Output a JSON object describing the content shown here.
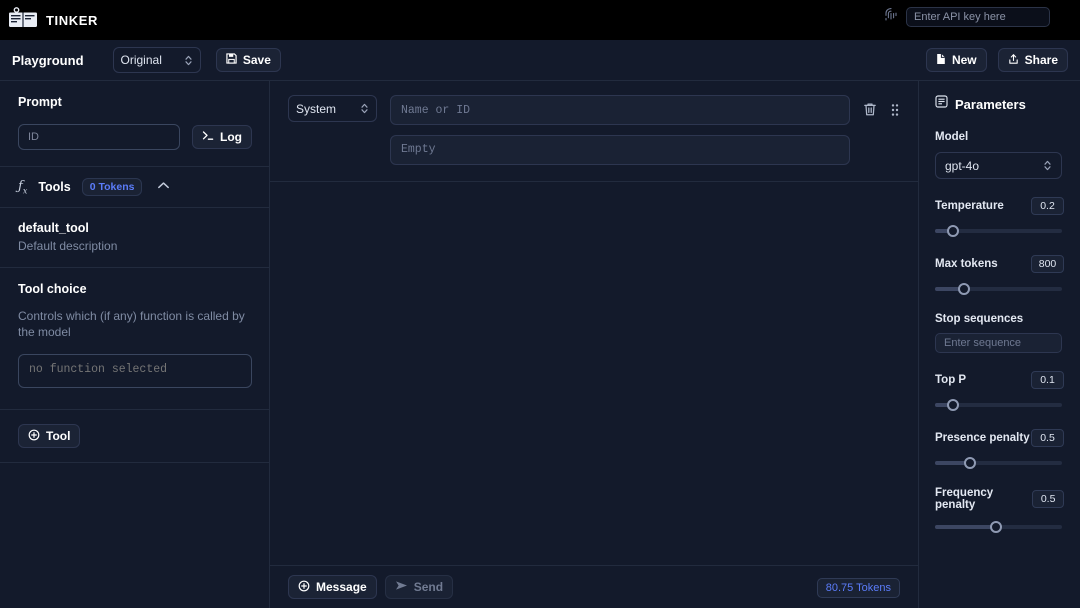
{
  "topbar": {
    "brand": "TINKER",
    "logo_icon": "ledger-icon",
    "fingerprint_icon": "fingerprint-icon",
    "api_key_value": "",
    "api_key_placeholder": "Enter API key here"
  },
  "toolbar": {
    "title": "Playground",
    "preset_value": "Original",
    "save_label": "Save",
    "save_icon": "floppy-disk-icon",
    "new_label": "New",
    "new_icon": "file-icon",
    "share_label": "Share",
    "share_icon": "share-upload-icon"
  },
  "sidebar": {
    "prompt": {
      "title": "Prompt",
      "id_value": "",
      "id_placeholder": "ID",
      "log_label": "Log",
      "log_icon": "terminal-icon"
    },
    "tools": {
      "icon": "fx-icon",
      "label": "Tools",
      "tokens_badge": "0 Tokens",
      "collapse_icon": "chevron-up-icon",
      "items": [
        {
          "name": "default_tool",
          "description": "Default description"
        }
      ]
    },
    "tool_choice": {
      "title": "Tool choice",
      "description": "Controls which (if any) function is called by the model",
      "value": "no function selected",
      "placeholder": "no function selected"
    },
    "add_tool": {
      "label": "Tool",
      "icon": "plus-circle-icon"
    }
  },
  "messages": [
    {
      "role": "System",
      "name_value": "",
      "name_placeholder": "Name or ID",
      "content_value": "",
      "content_placeholder": "Empty",
      "delete_icon": "trash-icon",
      "drag_icon": "drag-handle-icon"
    }
  ],
  "bottombar": {
    "message_label": "Message",
    "message_icon": "plus-circle-icon",
    "send_label": "Send",
    "send_icon": "send-arrow-icon",
    "tokens": "80.75 Tokens"
  },
  "parameters": {
    "icon": "sliders-icon",
    "title": "Parameters",
    "model": {
      "label": "Model",
      "value": "gpt-4o"
    },
    "sliders": [
      {
        "label": "Temperature",
        "value": "0.2",
        "percent": 10
      },
      {
        "label": "Max tokens",
        "value": "800",
        "percent": 20
      },
      {
        "label": "Top P",
        "value": "0.1",
        "percent": 10
      },
      {
        "label": "Presence penalty",
        "value": "0.5",
        "percent": 25
      },
      {
        "label": "Frequency penalty",
        "value": "0.5",
        "percent": 48
      }
    ],
    "stop_sequences": {
      "label": "Stop sequences",
      "value": "",
      "placeholder": "Enter sequence"
    }
  },
  "colors": {
    "background": "#131a2b",
    "topbar": "#000000",
    "accent": "#5b7cfa",
    "border": "#222b3e",
    "muted_text": "#7f8ba3"
  }
}
